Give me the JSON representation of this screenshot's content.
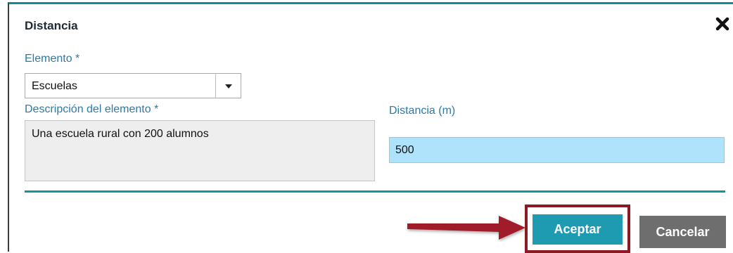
{
  "dialog": {
    "title": "Distancia",
    "close_icon": "close-icon"
  },
  "form": {
    "elemento_label": "Elemento *",
    "elemento_value": "Escuelas",
    "dropdown_icon": "chevron-down-icon",
    "descripcion_label": "Descripción del elemento *",
    "descripcion_value": "Una escuela rural con 200 alumnos",
    "distancia_label": "Distancia (m)",
    "distancia_value": "500"
  },
  "buttons": {
    "accept_label": "Aceptar",
    "cancel_label": "Cancelar"
  },
  "annotation": {
    "arrow_icon": "red-arrow-icon",
    "highlight_color": "#8b1a24"
  },
  "colors": {
    "accent": "#10979b",
    "label_blue": "#2e79a6",
    "accept_button": "#1e9bb0",
    "cancel_button": "#6e6e6e",
    "active_input": "#aee3fb"
  }
}
